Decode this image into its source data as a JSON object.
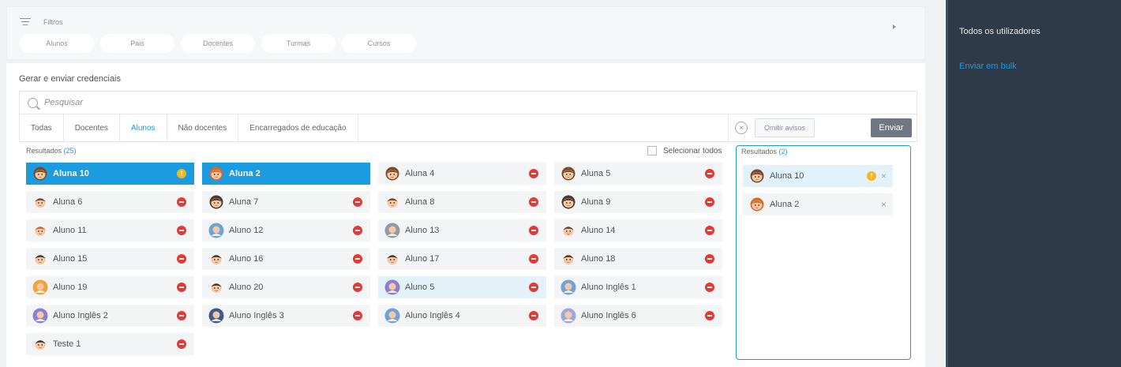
{
  "filters": {
    "title": "Filtros",
    "pills": [
      "Alunos",
      "Pais",
      "Docentes",
      "Turmas",
      "Cursos"
    ]
  },
  "main": {
    "title": "Gerar e enviar credenciais",
    "search_placeholder": "Pesquisar",
    "tabs": [
      "Todas",
      "Docentes",
      "Alunos",
      "Não docentes",
      "Encarregados de educação"
    ],
    "active_tab": "Alunos",
    "omit_label": "Omitir avisos",
    "send_label": "Enviar",
    "results_label": "Resultados",
    "results_count": "(25)",
    "select_all_label": "Selecionar todos"
  },
  "people": [
    {
      "name": "Aluna 10",
      "state": "selected",
      "status": "warn",
      "avatar": "girl-brown"
    },
    {
      "name": "Aluna 2",
      "state": "selected",
      "status": "none",
      "avatar": "girl-red"
    },
    {
      "name": "Aluna 4",
      "state": "normal",
      "status": "remove",
      "avatar": "girl-brown"
    },
    {
      "name": "Aluna 5",
      "state": "normal",
      "status": "remove",
      "avatar": "girl-brown"
    },
    {
      "name": "Aluna 6",
      "state": "normal",
      "status": "remove",
      "avatar": "boy-brown"
    },
    {
      "name": "Aluna 7",
      "state": "normal",
      "status": "remove",
      "avatar": "girl-dark"
    },
    {
      "name": "Aluna 8",
      "state": "normal",
      "status": "remove",
      "avatar": "boy-brown"
    },
    {
      "name": "Aluna 9",
      "state": "normal",
      "status": "remove",
      "avatar": "girl-dark"
    },
    {
      "name": "Aluno 11",
      "state": "normal",
      "status": "remove",
      "avatar": "boy-red"
    },
    {
      "name": "Aluno 12",
      "state": "normal",
      "status": "remove",
      "avatar": "round-blue"
    },
    {
      "name": "Aluno 13",
      "state": "normal",
      "status": "remove",
      "avatar": "round-grey"
    },
    {
      "name": "Aluno 14",
      "state": "normal",
      "status": "remove",
      "avatar": "boy-brown"
    },
    {
      "name": "Aluno 15",
      "state": "normal",
      "status": "remove",
      "avatar": "boy-dark"
    },
    {
      "name": "Aluno 16",
      "state": "normal",
      "status": "remove",
      "avatar": "boy-dark"
    },
    {
      "name": "Aluno 17",
      "state": "normal",
      "status": "remove",
      "avatar": "boy-dark"
    },
    {
      "name": "Aluno 18",
      "state": "normal",
      "status": "remove",
      "avatar": "boy-dark"
    },
    {
      "name": "Aluno 19",
      "state": "normal",
      "status": "remove",
      "avatar": "round-orange"
    },
    {
      "name": "Aluno 20",
      "state": "normal",
      "status": "remove",
      "avatar": "boy-dark"
    },
    {
      "name": "Aluno 5",
      "state": "light",
      "status": "remove",
      "avatar": "round-purple"
    },
    {
      "name": "Aluno Inglês 1",
      "state": "normal",
      "status": "remove",
      "avatar": "round-blue"
    },
    {
      "name": "Aluno Inglês 2",
      "state": "normal",
      "status": "remove",
      "avatar": "round-purple"
    },
    {
      "name": "Aluno Inglês 3",
      "state": "normal",
      "status": "remove",
      "avatar": "round-navy"
    },
    {
      "name": "Aluno Inglês 4",
      "state": "normal",
      "status": "remove",
      "avatar": "round-blue"
    },
    {
      "name": "Aluno Inglês 6",
      "state": "normal",
      "status": "remove",
      "avatar": "round-lilac"
    },
    {
      "name": "Teste 1",
      "state": "normal",
      "status": "remove",
      "avatar": "boy-dark"
    }
  ],
  "selected_panel": {
    "results_label": "Resultados",
    "count": "(2)",
    "items": [
      {
        "name": "Aluna 10",
        "warn": true,
        "avatar": "girl-brown"
      },
      {
        "name": "Aluna 2",
        "warn": false,
        "avatar": "girl-red"
      }
    ]
  },
  "sidebar": {
    "items": [
      "Todos os utilizadores",
      "Enviar em bulk"
    ]
  },
  "colors": {
    "accent": "#1b9be0",
    "remove": "#e53935",
    "warn": "#f5b521",
    "sidebar_bg": "#2f3a48"
  }
}
